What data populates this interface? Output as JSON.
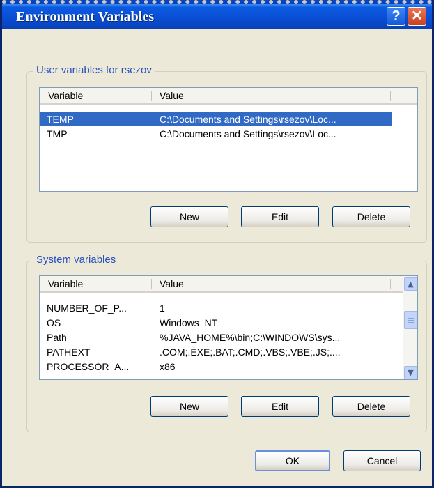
{
  "window": {
    "title": "Environment Variables",
    "help_label": "?",
    "close_label": "✕"
  },
  "user_vars": {
    "group_label": "User variables for rsezov",
    "col_variable": "Variable",
    "col_value": "Value",
    "rows": [
      {
        "variable": "TEMP",
        "value": "C:\\Documents and Settings\\rsezov\\Loc...",
        "selected": true
      },
      {
        "variable": "TMP",
        "value": "C:\\Documents and Settings\\rsezov\\Loc...",
        "selected": false
      }
    ],
    "new_label": "New",
    "edit_label": "Edit",
    "delete_label": "Delete"
  },
  "system_vars": {
    "group_label": "System variables",
    "col_variable": "Variable",
    "col_value": "Value",
    "rows": [
      {
        "variable": "NUMBER_OF_P...",
        "value": "1"
      },
      {
        "variable": "OS",
        "value": "Windows_NT"
      },
      {
        "variable": "Path",
        "value": "%JAVA_HOME%\\bin;C:\\WINDOWS\\sys..."
      },
      {
        "variable": "PATHEXT",
        "value": ".COM;.EXE;.BAT;.CMD;.VBS;.VBE;.JS;...."
      },
      {
        "variable": "PROCESSOR_A...",
        "value": "x86"
      }
    ],
    "new_label": "New",
    "edit_label": "Edit",
    "delete_label": "Delete"
  },
  "footer": {
    "ok_label": "OK",
    "cancel_label": "Cancel"
  },
  "colors": {
    "selection": "#316ac5",
    "titlebar": "#0a4fd6",
    "group_label": "#2a52be"
  }
}
